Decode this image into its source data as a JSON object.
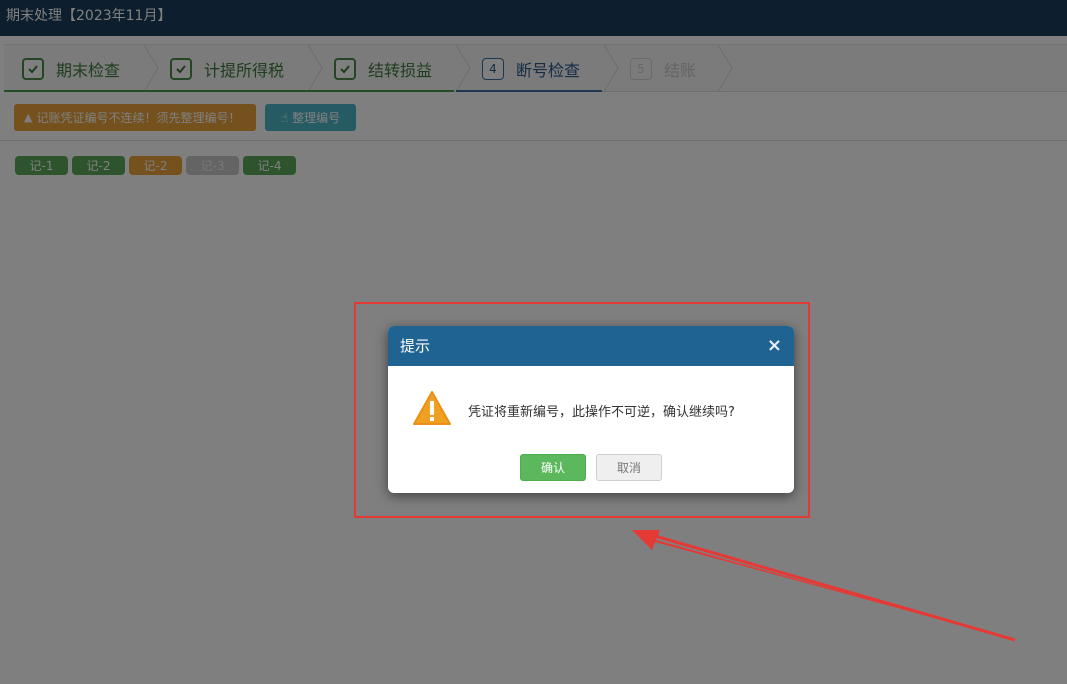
{
  "window": {
    "title": "期末处理【2023年11月】"
  },
  "steps": [
    {
      "label": "期末检查",
      "state": "done"
    },
    {
      "label": "计提所得税",
      "state": "done"
    },
    {
      "label": "结转损益",
      "state": "done"
    },
    {
      "num": "4",
      "label": "断号检查",
      "state": "active"
    },
    {
      "num": "5",
      "label": "结账",
      "state": "disabled"
    }
  ],
  "toolbar": {
    "warning_label": "记账凭证编号不连续！须先整理编号！",
    "renumber_label": "整理编号"
  },
  "tags": [
    {
      "label": "记-1",
      "color": "green"
    },
    {
      "label": "记-2",
      "color": "green"
    },
    {
      "label": "记-2",
      "color": "orange"
    },
    {
      "label": "记-3",
      "color": "gray"
    },
    {
      "label": "记-4",
      "color": "green"
    }
  ],
  "dialog": {
    "title": "提示",
    "message": "凭证将重新编号，此操作不可逆，确认继续吗?",
    "ok_label": "确认",
    "cancel_label": "取消",
    "close_icon": "×"
  },
  "colors": {
    "titlebar": "#1b3f5c",
    "dialog_header": "#1e6391",
    "ok_button": "#5cb85c",
    "warning": "#e9a33b",
    "annotation": "#e53935"
  }
}
